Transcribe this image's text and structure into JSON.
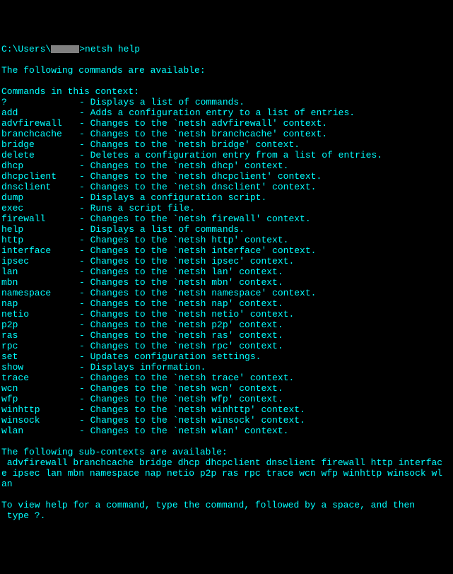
{
  "prompt": {
    "path_prefix": "C:\\Users\\",
    "path_suffix": ">",
    "command": "netsh help"
  },
  "header": "The following commands are available:",
  "context_header": "Commands in this context:",
  "commands": [
    {
      "name": "?",
      "desc": "- Displays a list of commands."
    },
    {
      "name": "add",
      "desc": "- Adds a configuration entry to a list of entries."
    },
    {
      "name": "advfirewall",
      "desc": "- Changes to the `netsh advfirewall' context."
    },
    {
      "name": "branchcache",
      "desc": "- Changes to the `netsh branchcache' context."
    },
    {
      "name": "bridge",
      "desc": "- Changes to the `netsh bridge' context."
    },
    {
      "name": "delete",
      "desc": "- Deletes a configuration entry from a list of entries."
    },
    {
      "name": "dhcp",
      "desc": "- Changes to the `netsh dhcp' context."
    },
    {
      "name": "dhcpclient",
      "desc": "- Changes to the `netsh dhcpclient' context."
    },
    {
      "name": "dnsclient",
      "desc": "- Changes to the `netsh dnsclient' context."
    },
    {
      "name": "dump",
      "desc": "- Displays a configuration script."
    },
    {
      "name": "exec",
      "desc": "- Runs a script file."
    },
    {
      "name": "firewall",
      "desc": "- Changes to the `netsh firewall' context."
    },
    {
      "name": "help",
      "desc": "- Displays a list of commands."
    },
    {
      "name": "http",
      "desc": "- Changes to the `netsh http' context."
    },
    {
      "name": "interface",
      "desc": "- Changes to the `netsh interface' context."
    },
    {
      "name": "ipsec",
      "desc": "- Changes to the `netsh ipsec' context."
    },
    {
      "name": "lan",
      "desc": "- Changes to the `netsh lan' context."
    },
    {
      "name": "mbn",
      "desc": "- Changes to the `netsh mbn' context."
    },
    {
      "name": "namespace",
      "desc": "- Changes to the `netsh namespace' context."
    },
    {
      "name": "nap",
      "desc": "- Changes to the `netsh nap' context."
    },
    {
      "name": "netio",
      "desc": "- Changes to the `netsh netio' context."
    },
    {
      "name": "p2p",
      "desc": "- Changes to the `netsh p2p' context."
    },
    {
      "name": "ras",
      "desc": "- Changes to the `netsh ras' context."
    },
    {
      "name": "rpc",
      "desc": "- Changes to the `netsh rpc' context."
    },
    {
      "name": "set",
      "desc": "- Updates configuration settings."
    },
    {
      "name": "show",
      "desc": "- Displays information."
    },
    {
      "name": "trace",
      "desc": "- Changes to the `netsh trace' context."
    },
    {
      "name": "wcn",
      "desc": "- Changes to the `netsh wcn' context."
    },
    {
      "name": "wfp",
      "desc": "- Changes to the `netsh wfp' context."
    },
    {
      "name": "winhttp",
      "desc": "- Changes to the `netsh winhttp' context."
    },
    {
      "name": "winsock",
      "desc": "- Changes to the `netsh winsock' context."
    },
    {
      "name": "wlan",
      "desc": "- Changes to the `netsh wlan' context."
    }
  ],
  "subcontexts_header": "The following sub-contexts are available:",
  "subcontexts_line1": " advfirewall branchcache bridge dhcp dhcpclient dnsclient firewall http interfac",
  "subcontexts_line2": "e ipsec lan mbn namespace nap netio p2p ras rpc trace wcn wfp winhttp winsock wl",
  "subcontexts_line3": "an",
  "footer_line1": "To view help for a command, type the command, followed by a space, and then",
  "footer_line2": " type ?."
}
